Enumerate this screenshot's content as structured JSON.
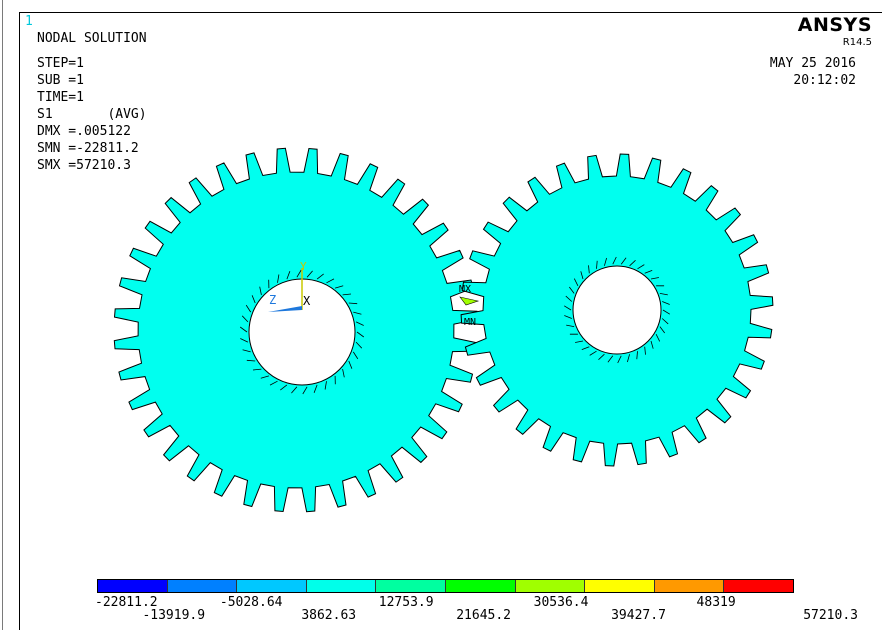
{
  "window": {
    "number": "1",
    "brand": "ANSYS",
    "version": "R14.5"
  },
  "header": {
    "title": "NODAL SOLUTION",
    "step": "STEP=1",
    "sub": "SUB =1",
    "time": "TIME=1",
    "item": "S1       (AVG)",
    "dmx": "DMX =.005122",
    "smn": "SMN =-22811.2",
    "smx": "SMX =57210.3"
  },
  "datetime": {
    "date": "MAY 25 2016",
    "time": "20:12:02"
  },
  "triad": {
    "y": "Y",
    "z": "Z",
    "x": "X"
  },
  "markers": {
    "mx": "MX",
    "mn": "MN"
  },
  "colors": {
    "gear": "#00ffef",
    "outline": "#000000",
    "triad_y": "#c8c800",
    "triad_z": "#1e78dc"
  },
  "legend": {
    "colors": [
      "#0000ff",
      "#0080ff",
      "#00c8ff",
      "#00ffea",
      "#00ffa0",
      "#00ff00",
      "#a0ff00",
      "#ffff00",
      "#ff9900",
      "#ff0000"
    ],
    "values": [
      "-22811.2",
      "-13919.9",
      "-5028.64",
      "3862.63",
      "12753.9",
      "21645.2",
      "30536.4",
      "39427.7",
      "48319",
      "57210.3"
    ]
  }
}
